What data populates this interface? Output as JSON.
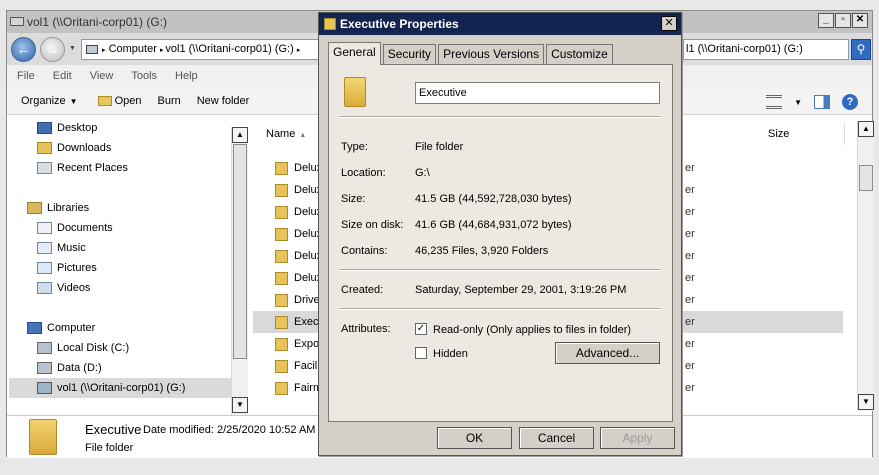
{
  "explorer": {
    "title": "vol1 (\\\\Oritani-corp01) (G:)",
    "address": {
      "parts": [
        "Computer",
        "vol1 (\\\\Oritani-corp01) (G:)"
      ],
      "right_text": "l1 (\\\\Oritani-corp01) (G:)"
    },
    "menu": [
      "File",
      "Edit",
      "View",
      "Tools",
      "Help"
    ],
    "toolbar": {
      "organize": "Organize",
      "open": "Open",
      "burn": "Burn",
      "new_folder": "New folder"
    },
    "nav": {
      "favorites": [
        "Desktop",
        "Downloads",
        "Recent Places"
      ],
      "libraries_label": "Libraries",
      "libraries": [
        "Documents",
        "Music",
        "Pictures",
        "Videos"
      ],
      "computer_label": "Computer",
      "drives": [
        "Local Disk (C:)",
        "Data (D:)",
        "vol1 (\\\\Oritani-corp01) (G:)"
      ]
    },
    "columns": {
      "name": "Name",
      "size": "Size"
    },
    "files": [
      {
        "name": "Deluxe",
        "type": "er"
      },
      {
        "name": "Deluxe",
        "type": "er"
      },
      {
        "name": "Deluxe",
        "type": "er"
      },
      {
        "name": "Deluxe",
        "type": "er"
      },
      {
        "name": "Deluxe",
        "type": "er"
      },
      {
        "name": "Deluxe",
        "type": "er"
      },
      {
        "name": "Driver",
        "type": "er"
      },
      {
        "name": "Execu",
        "type": "er"
      },
      {
        "name": "Export",
        "type": "er"
      },
      {
        "name": "Faciliti",
        "type": "er"
      },
      {
        "name": "Fairmo",
        "type": "er"
      }
    ],
    "details": {
      "name": "Executive",
      "modified": "Date modified: 2/25/2020 10:52 AM",
      "type": "File folder"
    }
  },
  "dialog": {
    "title": "Executive Properties",
    "tabs": [
      "General",
      "Security",
      "Previous Versions",
      "Customize"
    ],
    "folder_name": "Executive",
    "props": [
      {
        "label": "Type:",
        "value": "File folder"
      },
      {
        "label": "Location:",
        "value": "G:\\"
      },
      {
        "label": "Size:",
        "value": "41.5 GB (44,592,728,030 bytes)"
      },
      {
        "label": "Size on disk:",
        "value": "41.6 GB (44,684,931,072 bytes)"
      },
      {
        "label": "Contains:",
        "value": "46,235 Files, 3,920 Folders"
      }
    ],
    "created": {
      "label": "Created:",
      "value": "Saturday, September 29, 2001, 3:19:26 PM"
    },
    "attributes": {
      "label": "Attributes:",
      "readonly": "Read-only (Only applies to files in folder)",
      "hidden": "Hidden",
      "advanced": "Advanced..."
    },
    "buttons": {
      "ok": "OK",
      "cancel": "Cancel",
      "apply": "Apply"
    }
  }
}
